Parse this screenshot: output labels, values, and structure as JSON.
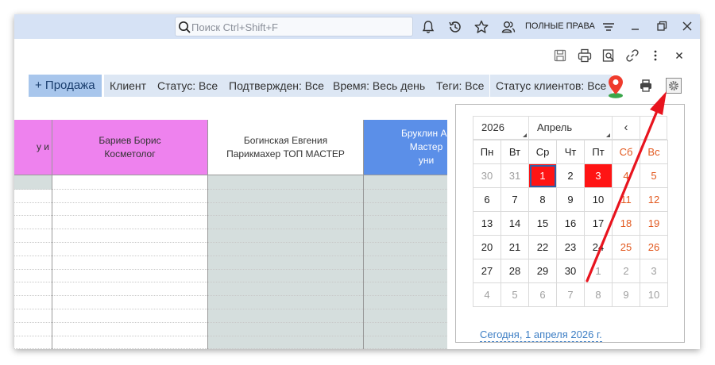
{
  "topbar": {
    "search_placeholder": "Поиск Ctrl+Shift+F",
    "rights_label": "ПОЛНЫЕ ПРАВА",
    "icons": [
      "bell-icon",
      "history-icon",
      "star-icon",
      "users-icon",
      "menu-icon",
      "minimize-icon",
      "restore-icon",
      "close-icon"
    ]
  },
  "toolbar_row": {
    "icons": [
      "save-icon",
      "print-icon",
      "print-preview-icon",
      "link-icon",
      "more-icon",
      "close-icon"
    ]
  },
  "filters": {
    "sale": "+ Продажа",
    "client": "Клиент",
    "status": "Статус: Все",
    "confirmed": "Подтвержден: Все",
    "time": "Время: Весь день",
    "tags": "Теги: Все",
    "client_status": "Статус клиентов: Все",
    "icons": [
      "location-pin-icon",
      "print-icon",
      "settings-icon"
    ]
  },
  "grid": {
    "columns": [
      {
        "line1": "у и",
        "line2": "",
        "header_color": "#ee82ee"
      },
      {
        "line1": "Бариев Борис",
        "line2": "Косметолог",
        "header_color": "#ee82ee"
      },
      {
        "line1": "Богинская Евгения",
        "line2": "Парикмахер ТОП МАСТЕР",
        "header_color": "#ffffff"
      },
      {
        "line1": "Бруклин А",
        "line2": "Мастер уни",
        "header_color": "#5b8fe8"
      }
    ]
  },
  "calendar": {
    "year": "2026",
    "month": "Апрель",
    "prev": "‹",
    "weekdays": [
      "Пн",
      "Вт",
      "Ср",
      "Чт",
      "Пт",
      "Сб",
      "Вс"
    ],
    "weeks": [
      [
        "30",
        "31",
        "1",
        "2",
        "3",
        "4",
        "5"
      ],
      [
        "6",
        "7",
        "8",
        "9",
        "10",
        "11",
        "12"
      ],
      [
        "13",
        "14",
        "15",
        "16",
        "17",
        "18",
        "19"
      ],
      [
        "20",
        "21",
        "22",
        "23",
        "24",
        "25",
        "26"
      ],
      [
        "27",
        "28",
        "29",
        "30",
        "1",
        "2",
        "3"
      ],
      [
        "4",
        "5",
        "6",
        "7",
        "8",
        "9",
        "10"
      ]
    ],
    "today_link": "Сегодня, 1 апреля 2026 г.",
    "highlight_color": "#ff1414"
  },
  "colors": {
    "topbar_bg": "#d6e2f5",
    "filter_bg": "#dde7f4",
    "sale_bg": "#a8c6ec",
    "grid_body_gray": "#d5dedd",
    "weekend": "#e2581e",
    "arrow": "#e8141e"
  }
}
